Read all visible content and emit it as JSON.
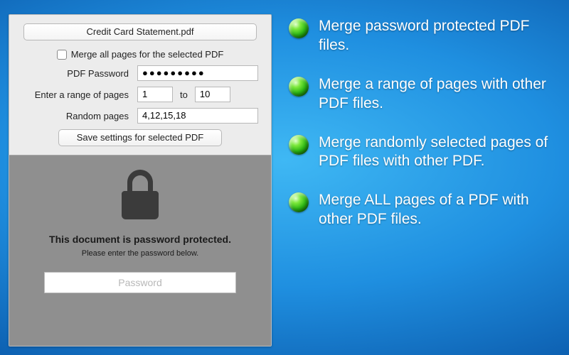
{
  "panel": {
    "file_name": "Credit Card Statement.pdf",
    "merge_all_label": "Merge all pages for the selected PDF",
    "password_label": "PDF Password",
    "password_value": "●●●●●●●●●",
    "range_label": "Enter a range of pages",
    "range_from": "1",
    "range_to_label": "to",
    "range_to": "10",
    "random_label": "Random pages",
    "random_value": "4,12,15,18",
    "save_button": "Save settings for selected PDF"
  },
  "locked": {
    "title": "This document is password protected.",
    "subtitle": "Please enter the password below.",
    "placeholder": "Password"
  },
  "features": [
    "Merge password protected PDF files.",
    "Merge a range of pages with other PDF files.",
    "Merge randomly selected pages of PDF files with other PDF.",
    "Merge ALL pages of a PDF with other PDF files."
  ]
}
